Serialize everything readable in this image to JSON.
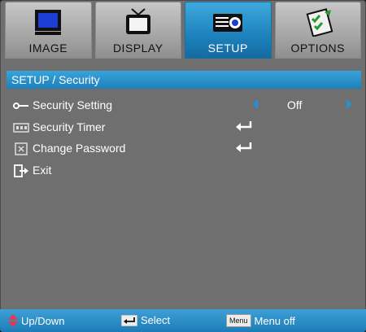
{
  "tabs": [
    {
      "label": "IMAGE",
      "icon": "monitor-icon",
      "active": false
    },
    {
      "label": "DISPLAY",
      "icon": "tv-icon",
      "active": false
    },
    {
      "label": "SETUP",
      "icon": "projector-icon",
      "active": true
    },
    {
      "label": "OPTIONS",
      "icon": "checklist-icon",
      "active": false
    }
  ],
  "section": {
    "title": "SETUP / Security"
  },
  "rows": [
    {
      "label": "Security Setting",
      "icon": "key-icon",
      "value": "Off"
    },
    {
      "label": "Security Timer",
      "icon": "timer-icon"
    },
    {
      "label": "Change Password",
      "icon": "password-icon"
    },
    {
      "label": "Exit",
      "icon": "exit-icon"
    }
  ],
  "footer": {
    "updown_label": "Up/Down",
    "select_label": "Select",
    "menu_key": "Menu",
    "menuoff_label": "Menu off"
  },
  "colors": {
    "accent": "#1c80bd",
    "panel": "#6f6f6f",
    "arrow": "#2a8fd0"
  }
}
